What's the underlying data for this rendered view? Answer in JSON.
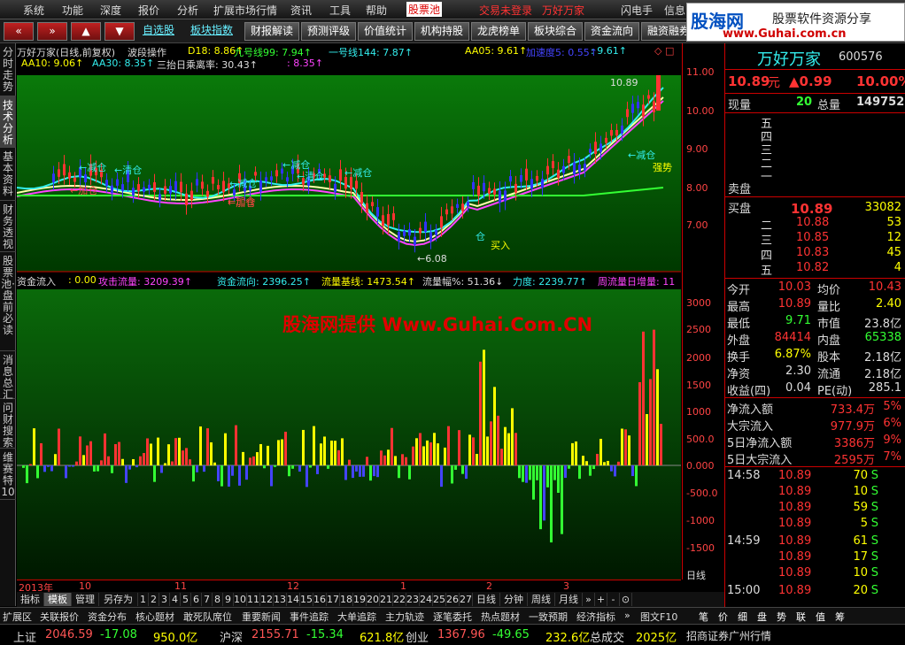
{
  "menu": [
    "系统",
    "功能",
    "深度",
    "报价",
    "分析",
    "扩展市场行情",
    "资讯",
    "工具",
    "帮助",
    "股票池",
    "交易未登录",
    "万好万家",
    "闪电手",
    "信息",
    "行"
  ],
  "toolbar": {
    "nav": [
      "«",
      "»",
      "▲",
      "▼"
    ],
    "links": [
      "自选股",
      "板块指数"
    ],
    "buttons": [
      "财报解读",
      "预测评级",
      "价值统计",
      "机构持股",
      "龙虎榜单",
      "板块综合",
      "资金流向",
      "融资融券",
      "持"
    ]
  },
  "logo": {
    "name": "股海网",
    "tagline": "股票软件资源分享",
    "url": "www.Guhai.com.cn"
  },
  "left_tabs": [
    "分时走势",
    "技术分析",
    "基本资料",
    "财务透视",
    "股票池·盘前必读",
    "消息总汇",
    "问财搜索",
    "维赛特10"
  ],
  "kline": {
    "header": [
      {
        "t": "万好万家(日线,前复权)",
        "c": "#ddd"
      },
      {
        "t": "波段操作",
        "c": "#ddd"
      },
      {
        "t": "D18: 8.86↑",
        "c": "#ff0"
      },
      {
        "t": "九号线99: 7.94↑",
        "c": "#3f3"
      },
      {
        "t": "一号线144: 7.87↑",
        "c": "#3ee"
      },
      {
        "t": "AA05: 9.61↑",
        "c": "#ff0"
      },
      {
        "t": "加速度5: 0.55↑",
        "c": "#44f"
      },
      {
        "t": ": 9.61↑",
        "c": "#3ee"
      },
      {
        "t": "◇ □",
        "c": "#f44"
      }
    ],
    "header2": [
      {
        "t": "AA10: 9.06↑",
        "c": "#ff0"
      },
      {
        "t": "AA30: 8.35↑",
        "c": "#3ee"
      },
      {
        "t": "三抬日乘离率: 30.43↑",
        "c": "#ddd"
      },
      {
        "t": ": 8.35↑",
        "c": "#f4f"
      }
    ],
    "annotations": [
      {
        "t": "←减仓",
        "c": "#3ee"
      },
      {
        "t": "←清仓",
        "c": "#3ee"
      },
      {
        "t": "←加仓",
        "c": "#f44"
      },
      {
        "t": "←减仓",
        "c": "#3ee"
      },
      {
        "t": "←加仓",
        "c": "#f44"
      },
      {
        "t": "←减仓",
        "c": "#3ee"
      },
      {
        "t": "←清仓",
        "c": "#3ee"
      },
      {
        "t": "←减仓",
        "c": "#3ee"
      },
      {
        "t": "←加仓",
        "c": "#f44"
      },
      {
        "t": "买入",
        "c": "#ff0"
      },
      {
        "t": "←6.08",
        "c": "#ddd"
      },
      {
        "t": "10.89",
        "c": "#ddd"
      },
      {
        "t": "←减仓",
        "c": "#3ee"
      },
      {
        "t": "强势",
        "c": "#ff0"
      },
      {
        "t": "仓",
        "c": "#3ee"
      }
    ],
    "ylabels": [
      "11.00",
      "10.00",
      "9.00",
      "8.00",
      "7.00"
    ]
  },
  "flow": {
    "header": [
      {
        "t": "资金流入",
        "c": "#ddd"
      },
      {
        "t": ": 0.00",
        "c": "#ff0"
      },
      {
        "t": "攻击流量: 3209.39↑",
        "c": "#f4f"
      },
      {
        "t": "资金流向: 2396.25↑",
        "c": "#3ee"
      },
      {
        "t": "流量基线: 1473.54↑",
        "c": "#ff0"
      },
      {
        "t": "流量幅%: 51.36↓",
        "c": "#ddd"
      },
      {
        "t": "力度: 2239.77↑",
        "c": "#3ee"
      },
      {
        "t": "周流量日增量: 11",
        "c": "#f4f"
      }
    ],
    "watermark": "股海网提供 Www.Guhai.Com.CN",
    "ylabels": [
      "3000",
      "2500",
      "2000",
      "1500",
      "1000",
      "500.0",
      "0.000",
      "-500.0",
      "-1000",
      "-1500"
    ]
  },
  "dates": [
    "2013年",
    "10",
    "11",
    "12",
    "1",
    "2",
    "3"
  ],
  "period_bar": [
    "指标",
    "模板",
    "管理",
    "另存为",
    "1",
    "2",
    "3",
    "4",
    "5",
    "6",
    "7",
    "8",
    "9",
    "10",
    "11",
    "12",
    "13",
    "14",
    "15",
    "16",
    "17",
    "18",
    "19",
    "20",
    "21",
    "22",
    "23",
    "24",
    "25",
    "26",
    "27",
    "日线",
    "分钟",
    "周线",
    "月线",
    "»",
    "+",
    "-",
    "⊙"
  ],
  "axis_period": "日线",
  "bottom_tabs": [
    "扩展区",
    "关联报价",
    "资金分布",
    "核心题材",
    "敢死队席位",
    "重要新闻",
    "事件追踪",
    "大单追踪",
    "主力轨迹",
    "逐笔委托",
    "热点题材",
    "一致预期",
    "经济指标",
    "»",
    "图文F10",
    "笔",
    "价",
    "细",
    "盘",
    "势",
    "联",
    "值",
    "筹"
  ],
  "status": [
    {
      "name": "上证",
      "price": "2046.59",
      "chg": "-17.08",
      "vol": "950.0亿"
    },
    {
      "name": "沪深",
      "price": "2155.71",
      "chg": "-15.34",
      "vol": "621.8亿"
    },
    {
      "name": "创业",
      "price": "1367.96",
      "chg": "-49.65",
      "vol": "232.6亿"
    }
  ],
  "status_extra": {
    "label": "总成交",
    "value": "2025亿",
    "broker": "招商证券广州行情"
  },
  "quote": {
    "name": "万好万家",
    "code": "600576",
    "price": "10.89",
    "unit": "元",
    "chg": "▲0.99",
    "pct": "10.00%",
    "now_label": "现量",
    "now": "20",
    "total_label": "总量",
    "total": "149752",
    "sell_label": "卖盘",
    "sell": [
      "五",
      "四",
      "三",
      "二",
      "一"
    ],
    "buy_label": "买盘",
    "buy": [
      {
        "lvl": "一",
        "p": "10.89",
        "v": "33082"
      },
      {
        "lvl": "二",
        "p": "10.88",
        "v": "53"
      },
      {
        "lvl": "三",
        "p": "10.85",
        "v": "12"
      },
      {
        "lvl": "四",
        "p": "10.83",
        "v": "45"
      },
      {
        "lvl": "五",
        "p": "10.82",
        "v": "4"
      }
    ],
    "stats": [
      [
        {
          "k": "今开",
          "v": "10.03",
          "c": "r"
        },
        {
          "k": "均价",
          "v": "10.43",
          "c": "r"
        }
      ],
      [
        {
          "k": "最高",
          "v": "10.89",
          "c": "r"
        },
        {
          "k": "量比",
          "v": "2.40",
          "c": "y"
        }
      ],
      [
        {
          "k": "最低",
          "v": "9.71",
          "c": "g"
        },
        {
          "k": "市值",
          "v": "23.8亿",
          "c": "w"
        }
      ],
      [
        {
          "k": "外盘",
          "v": "84414",
          "c": "r"
        },
        {
          "k": "内盘",
          "v": "65338",
          "c": "g"
        }
      ],
      [
        {
          "k": "换手",
          "v": "6.87%",
          "c": "y"
        },
        {
          "k": "股本",
          "v": "2.18亿",
          "c": "w"
        }
      ],
      [
        {
          "k": "净资",
          "v": "2.30",
          "c": "w"
        },
        {
          "k": "流通",
          "v": "2.18亿",
          "c": "w"
        }
      ],
      [
        {
          "k": "收益(四)",
          "v": "0.04",
          "c": "w"
        },
        {
          "k": "PE(动)",
          "v": "285.1",
          "c": "w"
        }
      ]
    ],
    "flows": [
      {
        "k": "净流入额",
        "v": "733.4万",
        "p": "5%"
      },
      {
        "k": "大宗流入",
        "v": "977.9万",
        "p": "6%"
      },
      {
        "k": "5日净流入额",
        "v": "3386万",
        "p": "9%"
      },
      {
        "k": "5日大宗流入",
        "v": "2595万",
        "p": "7%"
      }
    ],
    "ticks": [
      {
        "t": "14:58",
        "p": "10.89",
        "v": "70",
        "s": "S"
      },
      {
        "t": "",
        "p": "10.89",
        "v": "10",
        "s": "S"
      },
      {
        "t": "",
        "p": "10.89",
        "v": "59",
        "s": "S"
      },
      {
        "t": "",
        "p": "10.89",
        "v": "5",
        "s": "S"
      },
      {
        "t": "14:59",
        "p": "10.89",
        "v": "61",
        "s": "S"
      },
      {
        "t": "",
        "p": "10.89",
        "v": "17",
        "s": "S"
      },
      {
        "t": "",
        "p": "10.89",
        "v": "10",
        "s": "S"
      },
      {
        "t": "15:00",
        "p": "10.89",
        "v": "20",
        "s": "S"
      }
    ]
  }
}
